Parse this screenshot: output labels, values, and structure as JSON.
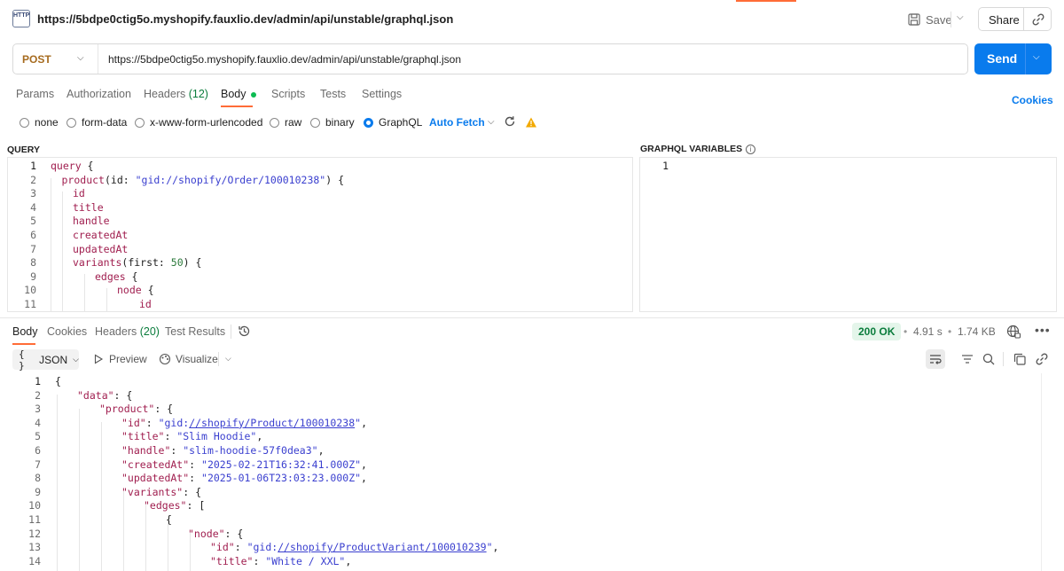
{
  "request": {
    "title": "https://5bdpe0ctig5o.myshopify.fauxlio.dev/admin/api/unstable/graphql.json",
    "icon_label": "HTTP",
    "save_label": "Save",
    "share_label": "Share",
    "method": "POST",
    "url": "https://5bdpe0ctig5o.myshopify.fauxlio.dev/admin/api/unstable/graphql.json",
    "send_label": "Send"
  },
  "request_tabs": [
    {
      "label": "Params"
    },
    {
      "label": "Authorization"
    },
    {
      "label": "Headers",
      "count": "(12)"
    },
    {
      "label": "Body"
    },
    {
      "label": "Scripts"
    },
    {
      "label": "Tests"
    },
    {
      "label": "Settings"
    }
  ],
  "cookies_label": "Cookies",
  "body_types": [
    {
      "label": "none",
      "selected": false
    },
    {
      "label": "form-data",
      "selected": false
    },
    {
      "label": "x-www-form-urlencoded",
      "selected": false
    },
    {
      "label": "raw",
      "selected": false
    },
    {
      "label": "binary",
      "selected": false
    },
    {
      "label": "GraphQL",
      "selected": true
    }
  ],
  "auto_fetch_label": "Auto Fetch",
  "query": {
    "label": "QUERY",
    "line_numbers": [
      "1",
      "2",
      "3",
      "4",
      "5",
      "6",
      "7",
      "8",
      "9",
      "10",
      "11"
    ],
    "lines": [
      {
        "indent": 0,
        "tokens": [
          [
            "kw",
            "query"
          ],
          [
            "",
            " {"
          ]
        ]
      },
      {
        "indent": 1,
        "tokens": [
          [
            "fld",
            "product"
          ],
          [
            "",
            "(id: "
          ],
          [
            "str",
            "\"gid://shopify/Order/100010238\""
          ],
          [
            "",
            ") {"
          ]
        ]
      },
      {
        "indent": 2,
        "tokens": [
          [
            "fld",
            "id"
          ]
        ]
      },
      {
        "indent": 2,
        "tokens": [
          [
            "fld",
            "title"
          ]
        ]
      },
      {
        "indent": 2,
        "tokens": [
          [
            "fld",
            "handle"
          ]
        ]
      },
      {
        "indent": 2,
        "tokens": [
          [
            "fld",
            "createdAt"
          ]
        ]
      },
      {
        "indent": 2,
        "tokens": [
          [
            "fld",
            "updatedAt"
          ]
        ]
      },
      {
        "indent": 2,
        "tokens": [
          [
            "fld",
            "variants"
          ],
          [
            "",
            "(first: "
          ],
          [
            "num",
            "50"
          ],
          [
            "",
            ") {"
          ]
        ]
      },
      {
        "indent": 4,
        "tokens": [
          [
            "fld",
            "edges"
          ],
          [
            "",
            " {"
          ]
        ]
      },
      {
        "indent": 6,
        "tokens": [
          [
            "fld",
            "node"
          ],
          [
            "",
            " {"
          ]
        ]
      },
      {
        "indent": 8,
        "tokens": [
          [
            "fld",
            "id"
          ]
        ]
      }
    ]
  },
  "variables": {
    "label": "GRAPHQL VARIABLES",
    "line_number": "1"
  },
  "response_tabs": [
    {
      "label": "Body"
    },
    {
      "label": "Cookies"
    },
    {
      "label": "Headers",
      "count": "(20)"
    },
    {
      "label": "Test Results"
    }
  ],
  "response_meta": {
    "status": "200 OK",
    "time": "4.91 s",
    "size": "1.74 KB"
  },
  "response_toolbar": {
    "format": "JSON",
    "format_brace": "{ }",
    "preview_label": "Preview",
    "visualize_label": "Visualize"
  },
  "response_body": {
    "line_numbers": [
      "1",
      "2",
      "3",
      "4",
      "5",
      "6",
      "7",
      "8",
      "9",
      "10",
      "11",
      "12",
      "13",
      "14"
    ],
    "lines": [
      {
        "indent": 0,
        "tokens": [
          [
            "",
            "{"
          ]
        ]
      },
      {
        "indent": 1,
        "tokens": [
          [
            "jk",
            "\"data\""
          ],
          [
            "",
            ": {"
          ]
        ]
      },
      {
        "indent": 2,
        "tokens": [
          [
            "jk",
            "\"product\""
          ],
          [
            "",
            ": {"
          ]
        ]
      },
      {
        "indent": 3,
        "tokens": [
          [
            "jk",
            "\"id\""
          ],
          [
            "",
            ": "
          ],
          [
            "js",
            "\"gid:"
          ],
          [
            "jl",
            "//shopify/Product/100010238"
          ],
          [
            "js",
            "\""
          ],
          [
            "",
            ","
          ]
        ]
      },
      {
        "indent": 3,
        "tokens": [
          [
            "jk",
            "\"title\""
          ],
          [
            "",
            ": "
          ],
          [
            "js",
            "\"Slim Hoodie\""
          ],
          [
            "",
            ","
          ]
        ]
      },
      {
        "indent": 3,
        "tokens": [
          [
            "jk",
            "\"handle\""
          ],
          [
            "",
            ": "
          ],
          [
            "js",
            "\"slim-hoodie-57f0dea3\""
          ],
          [
            "",
            ","
          ]
        ]
      },
      {
        "indent": 3,
        "tokens": [
          [
            "jk",
            "\"createdAt\""
          ],
          [
            "",
            ": "
          ],
          [
            "js",
            "\"2025-02-21T16:32:41.000Z\""
          ],
          [
            "",
            ","
          ]
        ]
      },
      {
        "indent": 3,
        "tokens": [
          [
            "jk",
            "\"updatedAt\""
          ],
          [
            "",
            ": "
          ],
          [
            "js",
            "\"2025-01-06T23:03:23.000Z\""
          ],
          [
            "",
            ","
          ]
        ]
      },
      {
        "indent": 3,
        "tokens": [
          [
            "jk",
            "\"variants\""
          ],
          [
            "",
            ": {"
          ]
        ]
      },
      {
        "indent": 4,
        "tokens": [
          [
            "jk",
            "\"edges\""
          ],
          [
            "",
            ": ["
          ]
        ]
      },
      {
        "indent": 5,
        "tokens": [
          [
            "",
            "{"
          ]
        ]
      },
      {
        "indent": 6,
        "tokens": [
          [
            "jk",
            "\"node\""
          ],
          [
            "",
            ": {"
          ]
        ]
      },
      {
        "indent": 7,
        "tokens": [
          [
            "jk",
            "\"id\""
          ],
          [
            "",
            ": "
          ],
          [
            "js",
            "\"gid:"
          ],
          [
            "jl",
            "//shopify/ProductVariant/100010239"
          ],
          [
            "js",
            "\""
          ],
          [
            "",
            ","
          ]
        ]
      },
      {
        "indent": 7,
        "tokens": [
          [
            "jk",
            "\"title\""
          ],
          [
            "",
            ": "
          ],
          [
            "js",
            "\"White / XXL\""
          ],
          [
            "",
            ","
          ]
        ]
      }
    ]
  },
  "colors": {
    "accent": "#097bed",
    "brand": "#ff6c37",
    "success": "#0a7c3c"
  }
}
